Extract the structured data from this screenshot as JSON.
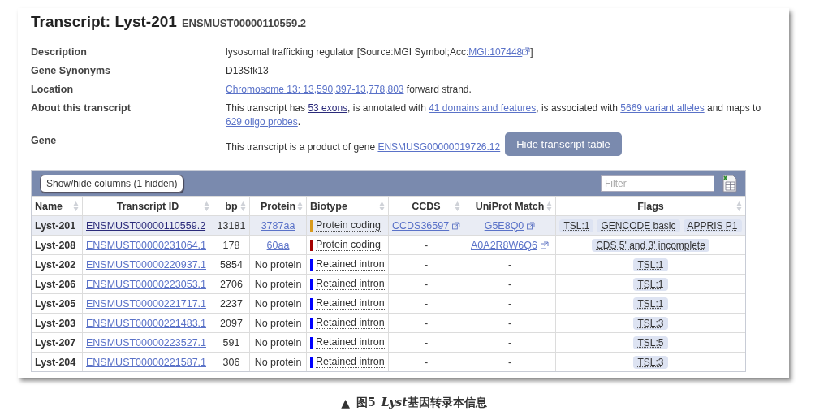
{
  "title": {
    "name": "Transcript: Lyst-201",
    "id": "ENSMUST00000110559.2"
  },
  "summary": [
    {
      "label": "Description",
      "parts": [
        {
          "text": "lysosomal trafficking regulator [Source:MGI Symbol;Acc:",
          "link": false
        },
        {
          "text": "MGI:107448",
          "link": true,
          "external": true
        },
        {
          "text": "]",
          "link": false
        }
      ]
    },
    {
      "label": "Gene Synonyms",
      "parts": [
        {
          "text": "D13Sfk13",
          "link": false
        }
      ]
    },
    {
      "label": "Location",
      "parts": [
        {
          "text": "Chromosome 13: 13,590,397-13,778,803",
          "link": true
        },
        {
          "text": " forward strand.",
          "link": false
        }
      ]
    },
    {
      "label": "About this transcript",
      "parts": [
        {
          "text": "This transcript has ",
          "link": false
        },
        {
          "text": "53 exons",
          "link": true,
          "visited": true
        },
        {
          "text": ", is annotated with ",
          "link": false
        },
        {
          "text": "41 domains and features",
          "link": true
        },
        {
          "text": ", is associated with ",
          "link": false
        },
        {
          "text": "5669 variant alleles",
          "link": true
        },
        {
          "text": " and maps to ",
          "link": false
        },
        {
          "text": "629 oligo probes",
          "link": true
        },
        {
          "text": ".",
          "link": false
        }
      ]
    },
    {
      "label": "Gene",
      "parts": [
        {
          "text": "This transcript is a product of gene ",
          "link": false
        },
        {
          "text": "ENSMUSG00000019726.12",
          "link": true
        }
      ],
      "button": "Hide transcript table"
    }
  ],
  "table": {
    "toggle_button": "Show/hide columns (1 hidden)",
    "filter": {
      "placeholder": "Filter"
    },
    "columns": [
      "Name",
      "Transcript ID",
      "bp",
      "Protein",
      "Biotype",
      "CCDS",
      "UniProt Match",
      "Flags"
    ],
    "rows": [
      {
        "name": "Lyst-201",
        "transcript_id": "ENSMUST00000110559.2",
        "bp": "13181",
        "protein": "3787aa",
        "protein_link": true,
        "biotype": "Protein coding",
        "color": "#d99a1c",
        "ccds": "CCDS36597",
        "ccds_link": true,
        "uniprot": "G5E8Q0",
        "uniprot_link": true,
        "flags": [
          "TSL:1",
          "GENCODE basic",
          "APPRIS P1"
        ],
        "selected": true
      },
      {
        "name": "Lyst-208",
        "transcript_id": "ENSMUST00000231064.1",
        "bp": "178",
        "protein": "60aa",
        "protein_link": true,
        "biotype": "Protein coding",
        "color": "#a40000",
        "ccds": "-",
        "ccds_link": false,
        "uniprot": "A0A2R8W6Q6",
        "uniprot_link": true,
        "flags": [
          "CDS 5' and 3' incomplete"
        ],
        "selected": false
      },
      {
        "name": "Lyst-202",
        "transcript_id": "ENSMUST00000220937.1",
        "bp": "5854",
        "protein": "No protein",
        "protein_link": false,
        "biotype": "Retained intron",
        "color": "#0000ff",
        "ccds": "-",
        "ccds_link": false,
        "uniprot": "-",
        "uniprot_link": false,
        "flags": [
          "TSL:1"
        ],
        "selected": false
      },
      {
        "name": "Lyst-206",
        "transcript_id": "ENSMUST00000223053.1",
        "bp": "2706",
        "protein": "No protein",
        "protein_link": false,
        "biotype": "Retained intron",
        "color": "#0000ff",
        "ccds": "-",
        "ccds_link": false,
        "uniprot": "-",
        "uniprot_link": false,
        "flags": [
          "TSL:1"
        ],
        "selected": false
      },
      {
        "name": "Lyst-205",
        "transcript_id": "ENSMUST00000221717.1",
        "bp": "2237",
        "protein": "No protein",
        "protein_link": false,
        "biotype": "Retained intron",
        "color": "#0000ff",
        "ccds": "-",
        "ccds_link": false,
        "uniprot": "-",
        "uniprot_link": false,
        "flags": [
          "TSL:1"
        ],
        "selected": false
      },
      {
        "name": "Lyst-203",
        "transcript_id": "ENSMUST00000221483.1",
        "bp": "2097",
        "protein": "No protein",
        "protein_link": false,
        "biotype": "Retained intron",
        "color": "#0000ff",
        "ccds": "-",
        "ccds_link": false,
        "uniprot": "-",
        "uniprot_link": false,
        "flags": [
          "TSL:3"
        ],
        "selected": false
      },
      {
        "name": "Lyst-207",
        "transcript_id": "ENSMUST00000223527.1",
        "bp": "591",
        "protein": "No protein",
        "protein_link": false,
        "biotype": "Retained intron",
        "color": "#0000ff",
        "ccds": "-",
        "ccds_link": false,
        "uniprot": "-",
        "uniprot_link": false,
        "flags": [
          "TSL:5"
        ],
        "selected": false
      },
      {
        "name": "Lyst-204",
        "transcript_id": "ENSMUST00000221587.1",
        "bp": "306",
        "protein": "No protein",
        "protein_link": false,
        "biotype": "Retained intron",
        "color": "#0000ff",
        "ccds": "-",
        "ccds_link": false,
        "uniprot": "-",
        "uniprot_link": false,
        "flags": [
          "TSL:3"
        ],
        "selected": false
      }
    ]
  },
  "caption": {
    "marker": "▲",
    "figure": "图5",
    "gene": "Lyst",
    "text": "基因转录本信息"
  }
}
